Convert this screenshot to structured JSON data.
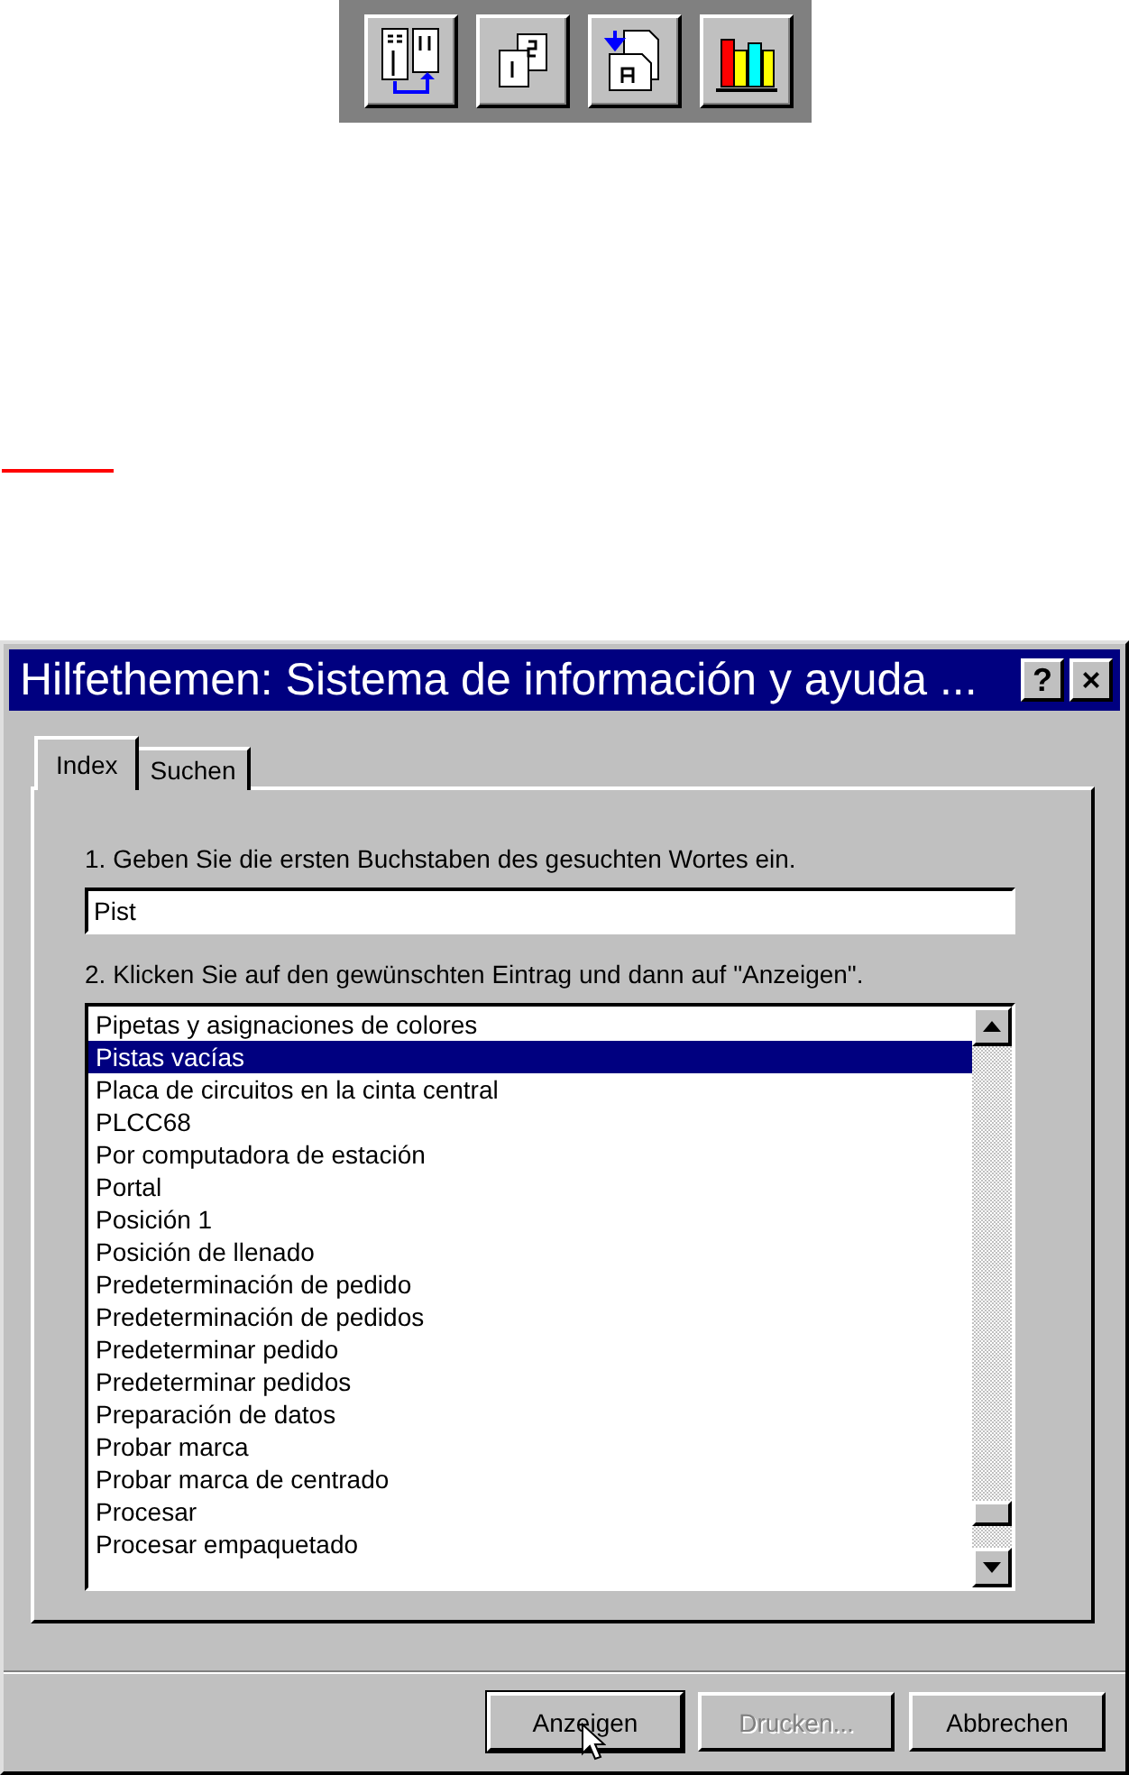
{
  "toolbar": {
    "buttons": [
      {
        "kind": "columns"
      },
      {
        "kind": "pages"
      },
      {
        "kind": "swap"
      },
      {
        "kind": "books"
      }
    ]
  },
  "dialog": {
    "title": "Hilfethemen: Sistema de información y ayuda ...",
    "help_button": "?",
    "close_button": "×",
    "tabs": [
      {
        "label": "Index",
        "selected": true
      },
      {
        "label": "Suchen",
        "selected": false
      }
    ],
    "step_1": "1. Geben Sie die ersten Buchstaben des gesuchten Wortes ein.",
    "search": {
      "value": "Pist"
    },
    "step_2": "2. Klicken Sie auf den gewünschten Eintrag und dann auf \"Anzeigen\".",
    "list": [
      {
        "label": "Pipetas y asignaciones de colores",
        "selected": false
      },
      {
        "label": "Pistas vacías",
        "selected": true
      },
      {
        "label": "Placa de circuitos en la cinta central",
        "selected": false
      },
      {
        "label": "PLCC68",
        "selected": false
      },
      {
        "label": "Por computadora de estación",
        "selected": false
      },
      {
        "label": "Portal",
        "selected": false
      },
      {
        "label": "Posición 1",
        "selected": false
      },
      {
        "label": "Posición de llenado",
        "selected": false
      },
      {
        "label": "Predeterminación de pedido",
        "selected": false
      },
      {
        "label": "Predeterminación de pedidos",
        "selected": false
      },
      {
        "label": "Predeterminar pedido",
        "selected": false
      },
      {
        "label": "Predeterminar pedidos",
        "selected": false
      },
      {
        "label": "Preparación de datos",
        "selected": false
      },
      {
        "label": "Probar marca",
        "selected": false
      },
      {
        "label": "Probar marca de centrado",
        "selected": false
      },
      {
        "label": "Procesar",
        "selected": false
      },
      {
        "label": "Procesar empaquetado",
        "selected": false
      }
    ],
    "buttons": [
      {
        "label": "Anzeigen",
        "disabled": false,
        "default": true
      },
      {
        "label": "Drucken...",
        "disabled": true,
        "default": false
      },
      {
        "label": "Abbrechen",
        "disabled": false,
        "default": false
      }
    ]
  }
}
